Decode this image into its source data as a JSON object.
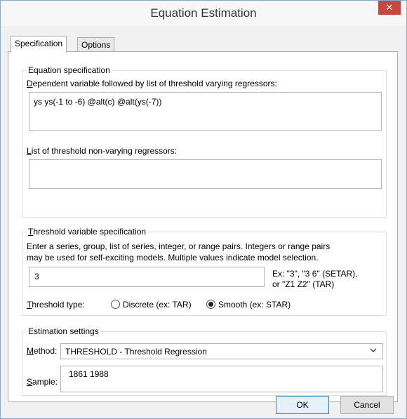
{
  "window": {
    "title": "Equation Estimation",
    "close_glyph": "✕"
  },
  "tabs": [
    {
      "label": "Specification",
      "active": true
    },
    {
      "label": "Options",
      "active": false
    }
  ],
  "equation_spec": {
    "legend": "Equation specification",
    "dependent_label": "Dependent variable followed by list of threshold varying regressors:",
    "dependent_value": "ys ys(-1 to -6) @alt(c) @alt(ys(-7))",
    "nonvarying_label": "List of threshold non-varying regressors:",
    "nonvarying_value": ""
  },
  "threshold_spec": {
    "legend": "Threshold variable specification",
    "desc_line1": "Enter a series, group, list of series, integer, or range pairs. Integers or range pairs",
    "desc_line2": "may be used for self-exciting models. Multiple values indicate model selection.",
    "value": "3",
    "hint_line1": "Ex: \"3\", \"3 6\" (SETAR),",
    "hint_line2": "or \"Z1 Z2\" (TAR)",
    "type_label": "Threshold type:",
    "options": [
      {
        "label": "Discrete (ex: TAR)",
        "checked": false
      },
      {
        "label": "Smooth (ex: STAR)",
        "checked": true
      }
    ]
  },
  "estimation_settings": {
    "legend": "Estimation settings",
    "method_label": "Method:",
    "method_value": "THRESHOLD  -  Threshold Regression",
    "sample_label": "Sample:",
    "sample_value": "1861 1988"
  },
  "buttons": {
    "ok": "OK",
    "cancel": "Cancel"
  },
  "icons": {
    "dropdown": "chevron-down-icon",
    "close": "close-icon"
  }
}
